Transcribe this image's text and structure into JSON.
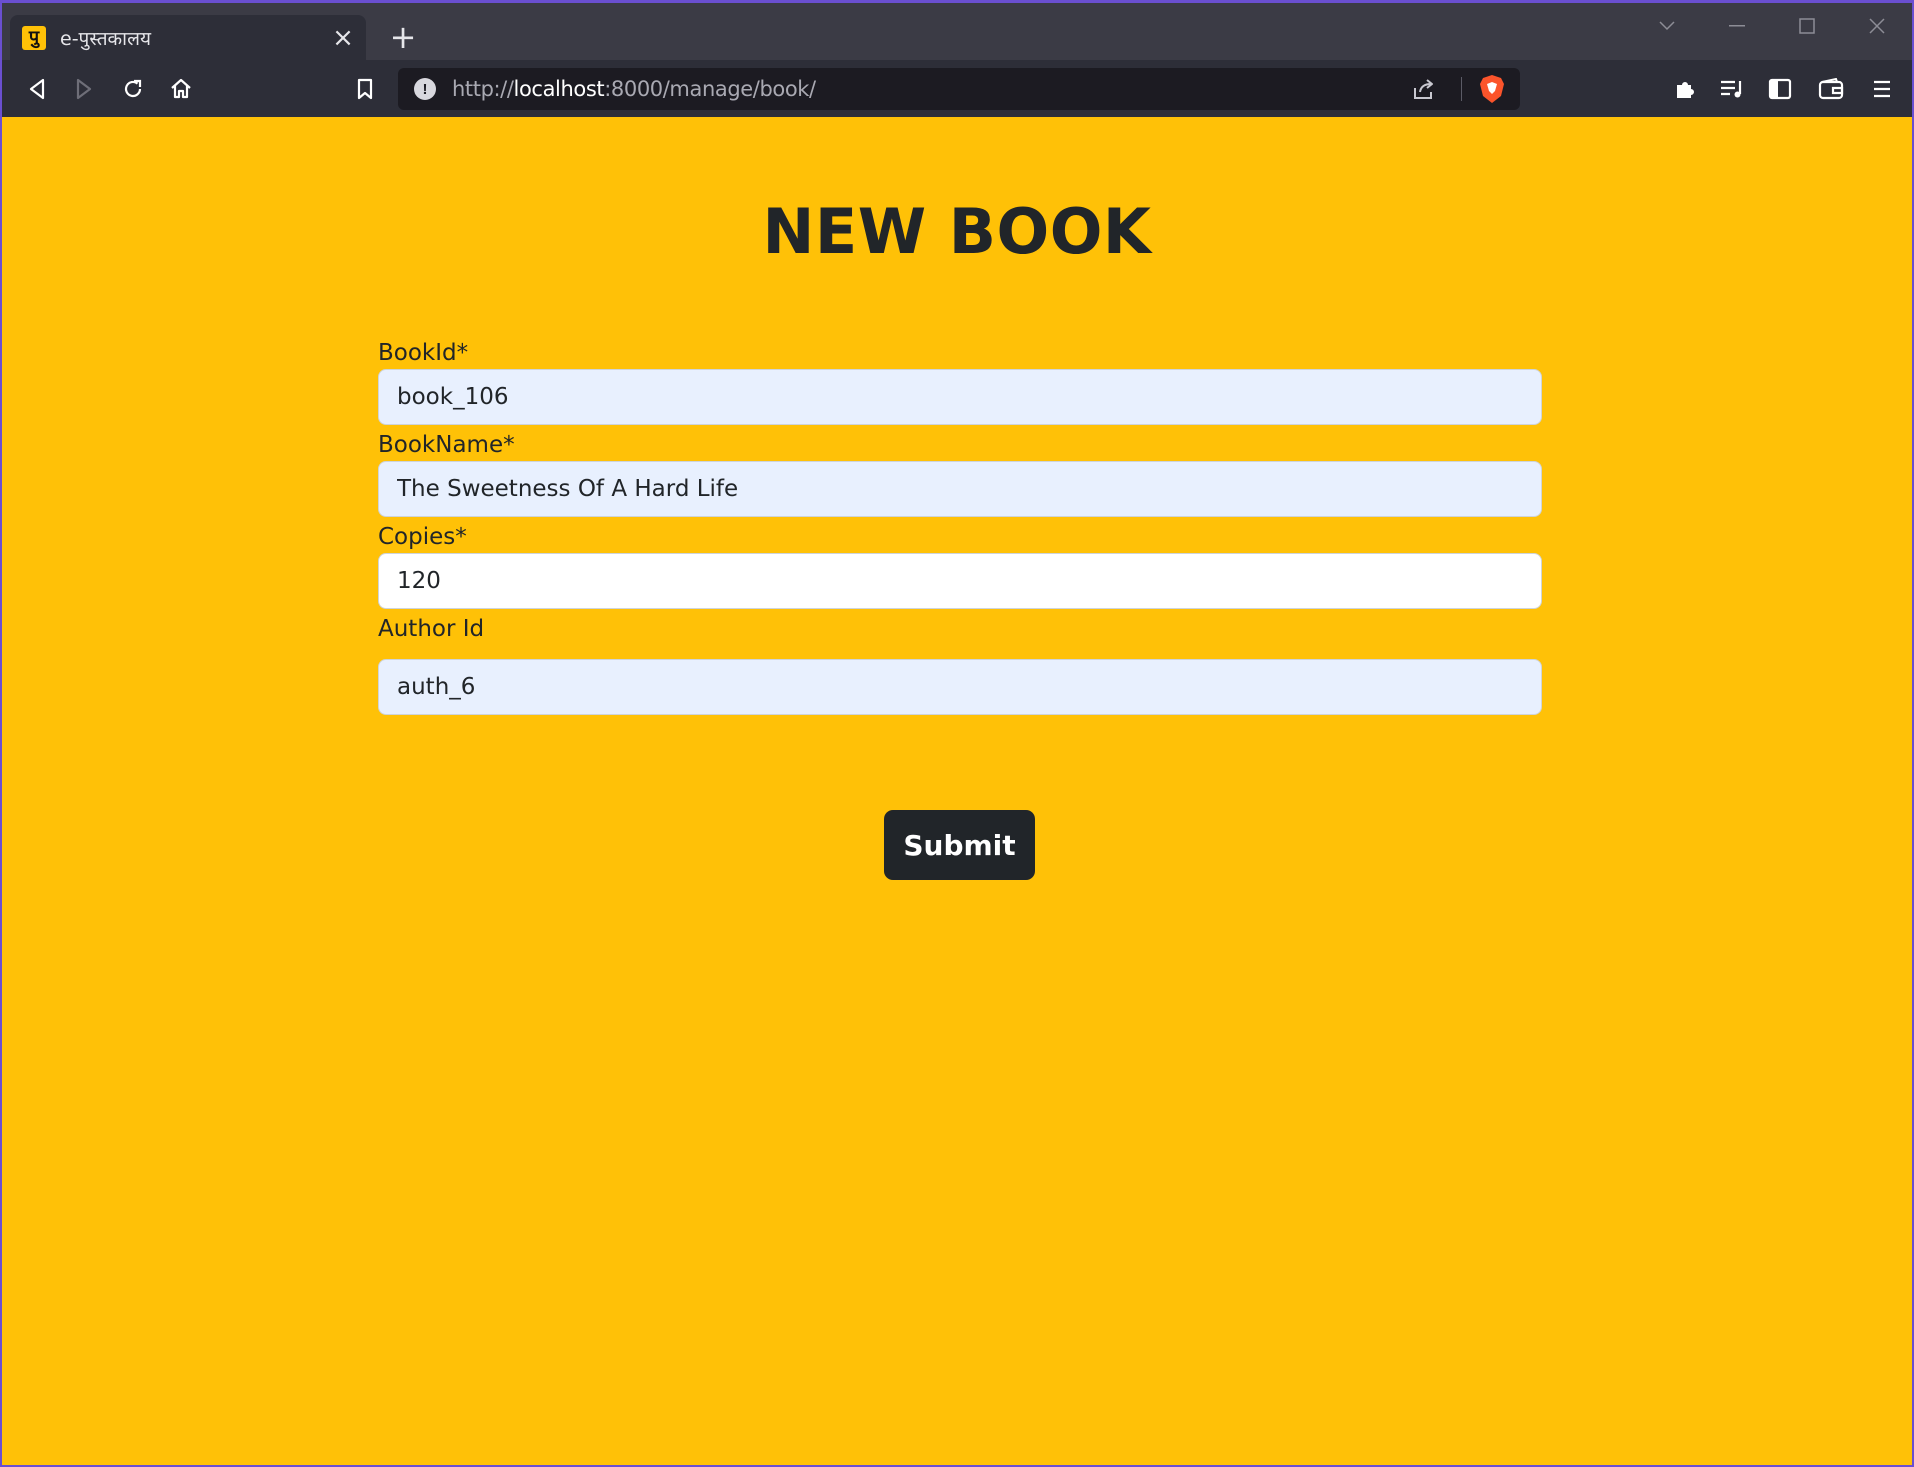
{
  "browser": {
    "tab": {
      "favicon": "पु",
      "title": "e-पुस्तकालय",
      "close_icon": "close-icon"
    },
    "new_tab_label": "+",
    "url": {
      "scheme": "http://",
      "host": "localhost",
      "rest": ":8000/manage/book/"
    }
  },
  "page": {
    "heading": "NEW BOOK",
    "fields": [
      {
        "label": "BookId*",
        "value": "book_106"
      },
      {
        "label": "BookName*",
        "value": "The Sweetness Of A Hard Life"
      },
      {
        "label": "Copies*",
        "value": "120"
      },
      {
        "label": "Author Id",
        "value": "auth_6"
      }
    ],
    "submit_label": "Submit"
  },
  "colors": {
    "page_bg": "#ffc107",
    "button_bg": "#212529",
    "autofill_bg": "#e8f0fe"
  }
}
